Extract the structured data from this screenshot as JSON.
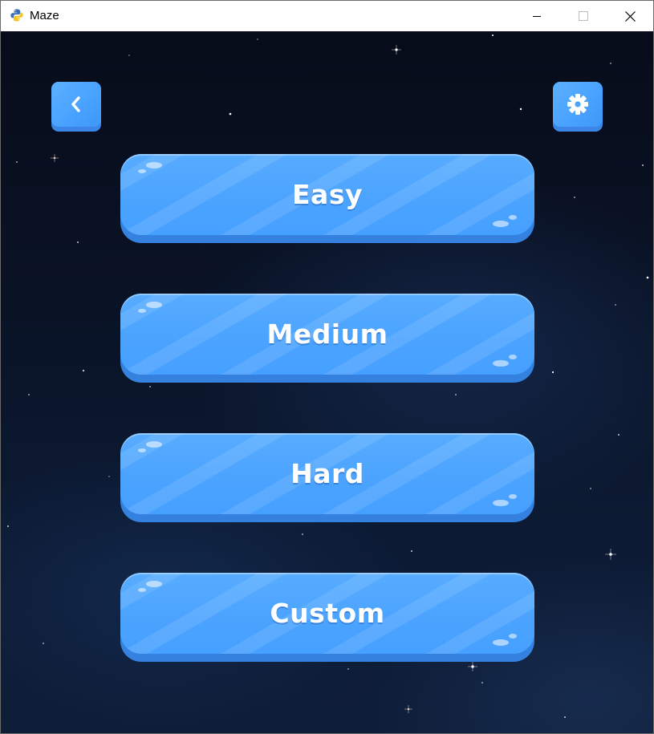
{
  "window": {
    "title": "Maze",
    "app_icon": "python-snake-icon",
    "controls": [
      "minimize-icon",
      "maximize-icon",
      "close-icon"
    ]
  },
  "toolbar": {
    "back_icon": "chevron-left-icon",
    "settings_icon": "gear-icon"
  },
  "difficulty": {
    "options": [
      "Easy",
      "Medium",
      "Hard",
      "Custom"
    ]
  },
  "colors": {
    "button": "#4aa3ff",
    "button_shadow": "#3481df",
    "background": "#0a1326",
    "label": "#ffffff"
  }
}
